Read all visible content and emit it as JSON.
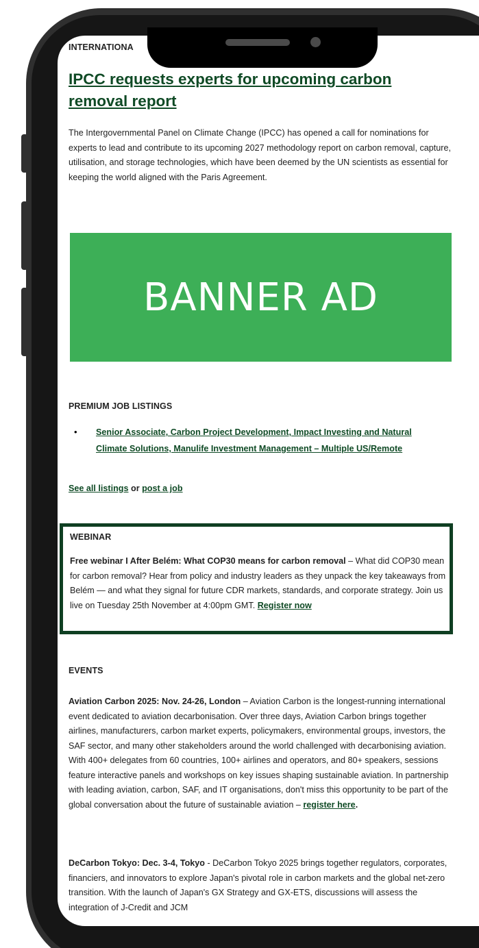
{
  "newsletter": {
    "section_international": "INTERNATIONA",
    "headline": "IPCC requests experts for upcoming carbon removal report",
    "intro": "The Intergovernmental Panel on Climate Change (IPCC) has opened a call for nominations for experts to lead and contribute to its upcoming 2027 methodology report on carbon removal, capture, utilisation, and storage technologies, which have been deemed by the UN scientists as essential for keeping the world aligned with the Paris Agreement.",
    "divider": "________________",
    "banner_ad": "BANNER AD",
    "jobs": {
      "label": "PREMIUM JOB LISTINGS",
      "items": [
        {
          "text": "Senior Associate, Carbon Project Development, Impact Investing and Natural Climate Solutions, Manulife Investment Management – Multiple US/Remote"
        }
      ],
      "see_all": "See all listings",
      "or": " or ",
      "post": "post a job"
    },
    "webinar": {
      "label": "WEBINAR",
      "title": "Free webinar I After Belém: What COP30 means for carbon removal",
      "body": " – What did COP30 mean for carbon removal? Hear from policy and industry leaders as they unpack the key takeaways from Belém — and what they signal for future CDR markets, standards, and corporate strategy. Join us live on Tuesday 25th November at 4:00pm GMT. ",
      "cta": "Register now"
    },
    "events": {
      "label": "EVENTS",
      "items": [
        {
          "title": "Aviation Carbon 2025: Nov. 24-26, London",
          "body": " – Aviation Carbon is the longest-running international event dedicated to aviation decarbonisation. Over three days, Aviation Carbon brings together airlines, manufacturers, carbon market experts, policymakers, environmental groups, investors, the SAF sector, and many other stakeholders around the world challenged with decarbonising aviation. With 400+ delegates from 60 countries, 100+ airlines and operators, and 80+ speakers, sessions feature interactive panels and workshops on key issues shaping sustainable aviation. In partnership with leading aviation, carbon, SAF, and IT organisations, don't miss this opportunity to be part of the global conversation about the future of sustainable aviation – ",
          "cta": "register here",
          "tail": "."
        },
        {
          "title": "DeCarbon Tokyo: Dec. 3-4, Tokyo",
          "body": " - DeCarbon Tokyo 2025 brings together regulators, corporates, financiers, and innovators to explore Japan's pivotal role in carbon markets and the global net-zero transition. With the launch of Japan's GX Strategy and GX-ETS, discussions will assess the integration of J-Credit and JCM"
        }
      ]
    }
  },
  "colors": {
    "accent_green": "#0f4a25",
    "banner_green": "#3daf57",
    "webinar_border": "#0f3f22",
    "phone_frame": "#2f2f2f"
  }
}
